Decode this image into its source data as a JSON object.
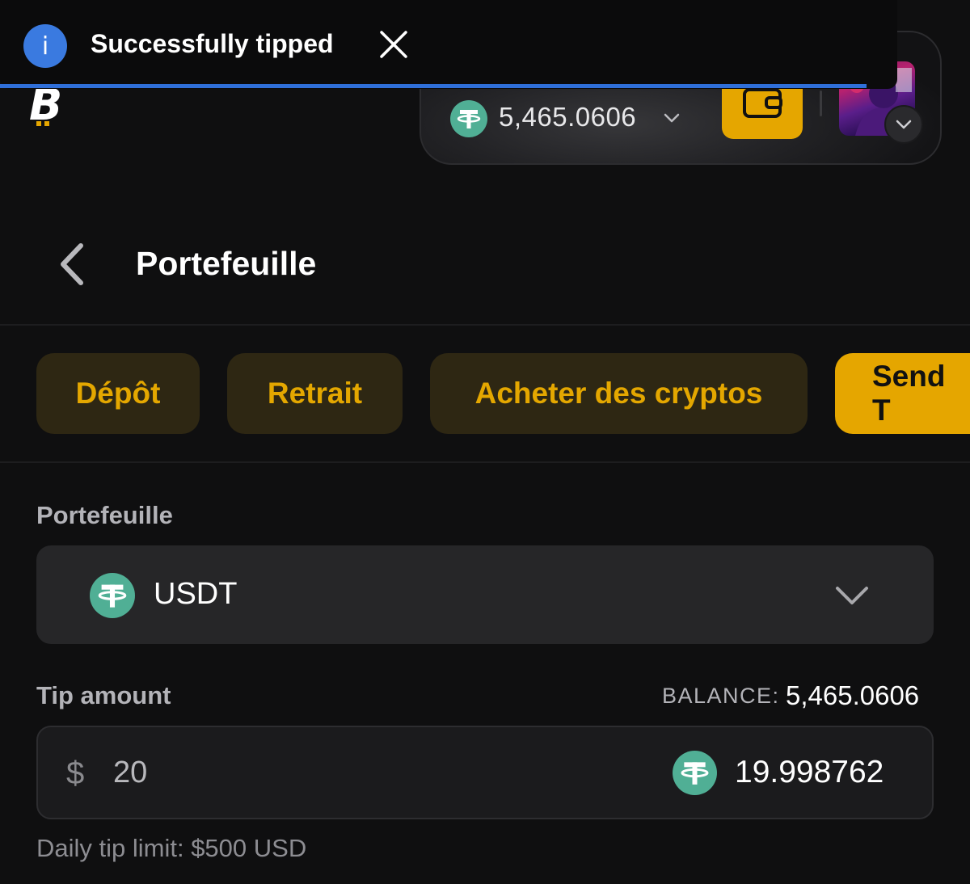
{
  "colors": {
    "accent": "#e5a600",
    "tether": "#50af95",
    "info": "#3a7ae0",
    "background": "#0f0f10"
  },
  "toast": {
    "message": "Successfully tipped",
    "icon": "info-icon",
    "close_icon": "close-icon"
  },
  "header": {
    "logo": "bitcoin-logo",
    "balance": "5,465.0606",
    "currency_icon": "tether-icon",
    "wallet_icon": "wallet-icon"
  },
  "page": {
    "title": "Portefeuille",
    "back_icon": "chevron-left-icon"
  },
  "tabs": [
    {
      "label": "Dépôt",
      "active": false
    },
    {
      "label": "Retrait",
      "active": false
    },
    {
      "label": "Acheter des cryptos",
      "active": false
    },
    {
      "label": "Send T",
      "active": true
    }
  ],
  "form": {
    "wallet_label": "Portefeuille",
    "selected_currency": "USDT",
    "tip_label": "Tip amount",
    "balance_label": "BALANCE:",
    "balance_value": "5,465.0606",
    "currency_symbol": "$",
    "amount_value": "20",
    "converted_amount": "19.998762",
    "daily_limit": "Daily tip limit: $500 USD"
  }
}
